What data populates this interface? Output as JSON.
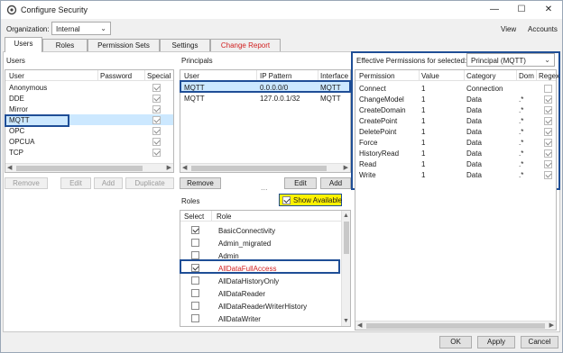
{
  "window": {
    "title": "Configure Security"
  },
  "org": {
    "label": "Organization:",
    "value": "Internal"
  },
  "menu": {
    "view": "View",
    "accounts": "Accounts"
  },
  "tabs": [
    {
      "label": "Users",
      "active": true
    },
    {
      "label": "Roles"
    },
    {
      "label": "Permission Sets"
    },
    {
      "label": "Settings"
    },
    {
      "label": "Change Report",
      "color": "#d11f1f"
    }
  ],
  "users": {
    "title": "Users",
    "columns": [
      "User",
      "Password",
      "Special"
    ],
    "rows": [
      {
        "name": "Anonymous",
        "special": true
      },
      {
        "name": "DDE",
        "special": true
      },
      {
        "name": "Mirror",
        "special": true
      },
      {
        "name": "MQTT",
        "special": true
      },
      {
        "name": "OPC",
        "special": true
      },
      {
        "name": "OPCUA",
        "special": true
      },
      {
        "name": "TCP",
        "special": true
      }
    ],
    "buttons": [
      "Remove",
      "Edit",
      "Add",
      "Duplicate"
    ]
  },
  "principals": {
    "title": "Principals",
    "columns": [
      "User",
      "IP Pattern",
      "Interface"
    ],
    "rows": [
      {
        "user": "MQTT",
        "ip": "0.0.0.0/0",
        "iface": "MQTT"
      },
      {
        "user": "MQTT",
        "ip": "127.0.0.1/32",
        "iface": "MQTT"
      }
    ],
    "buttons": [
      "Remove",
      "Edit",
      "Add"
    ],
    "ellipsis": "..."
  },
  "roles": {
    "title": "Roles",
    "show_available": "Show Available",
    "columns": [
      "Select",
      "Role"
    ],
    "rows": [
      {
        "name": "BasicConnectivity",
        "checked": true
      },
      {
        "name": "Admin_migrated",
        "checked": false
      },
      {
        "name": "Admin",
        "checked": false
      },
      {
        "name": "AllDataFullAccess",
        "checked": true,
        "color": "#d11f1f"
      },
      {
        "name": "AllDataHistoryOnly",
        "checked": false
      },
      {
        "name": "AllDataReader",
        "checked": false
      },
      {
        "name": "AllDataReaderWriterHistory",
        "checked": false
      },
      {
        "name": "AllDataWriter",
        "checked": false
      }
    ]
  },
  "effective": {
    "label": "Effective Permissions for selected:",
    "selected": "Principal  (MQTT)",
    "columns": [
      "Permission",
      "Value",
      "Category",
      "Dom",
      "Regex"
    ],
    "rows": [
      {
        "perm": "Connect",
        "value": "1",
        "cat": "Connection",
        "dom": "",
        "regex": false
      },
      {
        "perm": "ChangeModel",
        "value": "1",
        "cat": "Data",
        "dom": ".*",
        "regex": true
      },
      {
        "perm": "CreateDomain",
        "value": "1",
        "cat": "Data",
        "dom": ".*",
        "regex": true
      },
      {
        "perm": "CreatePoint",
        "value": "1",
        "cat": "Data",
        "dom": ".*",
        "regex": true
      },
      {
        "perm": "DeletePoint",
        "value": "1",
        "cat": "Data",
        "dom": ".*",
        "regex": true
      },
      {
        "perm": "Force",
        "value": "1",
        "cat": "Data",
        "dom": ".*",
        "regex": true
      },
      {
        "perm": "HistoryRead",
        "value": "1",
        "cat": "Data",
        "dom": ".*",
        "regex": true
      },
      {
        "perm": "Read",
        "value": "1",
        "cat": "Data",
        "dom": ".*",
        "regex": true
      },
      {
        "perm": "Write",
        "value": "1",
        "cat": "Data",
        "dom": ".*",
        "regex": true
      }
    ]
  },
  "footer": {
    "ok": "OK",
    "apply": "Apply",
    "cancel": "Cancel"
  },
  "colors": {
    "highlight": "#1f4e96",
    "selection": "#cce8ff",
    "show_available_bg": "#fff200"
  }
}
